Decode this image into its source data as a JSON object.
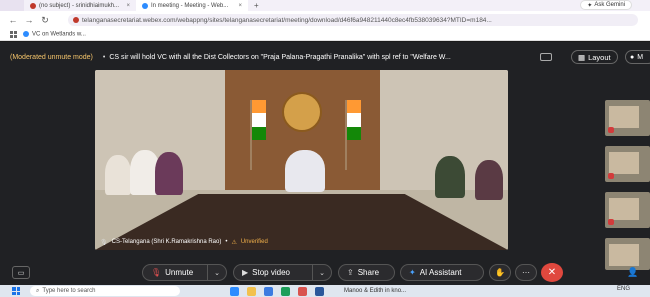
{
  "browser": {
    "tabs": [
      {
        "label": "(no subject) - srinidhiaimukh..."
      },
      {
        "label": "In meeting - Meeting - Web..."
      }
    ],
    "new_tab": "+",
    "gemini": "Ask Gemini",
    "url": "telanganasecretariat.webex.com/webappng/sites/telanganasecretariat/meeting/download/d46f6a948211440c8ec4fb538039634?MTID=m184...",
    "bookmark": "VC on Wetlands w..."
  },
  "meeting": {
    "moderated": "(Moderated unmute mode)",
    "topic": "CS sir will hold VC with all the Dist Collectors on \"Praja Palana-Pragathi Pranalika\" with spl ref to \"Welfare W...",
    "layout_label": "Layout",
    "more_label": "M",
    "speaker_name": "CS-Telangana (Shri K.Ramakrishna Rao)",
    "unverified": "Unverified"
  },
  "controls": {
    "unmute": "Unmute",
    "stop_video": "Stop video",
    "share": "Share",
    "ai_assistant": "AI Assistant"
  },
  "taskbar": {
    "search_placeholder": "Type here to search",
    "task_label": "Manoo & Edith in kno...",
    "lang": "ENG"
  },
  "colors": {
    "end_call": "#e0483e",
    "moderated": "#f5c56b",
    "unverified": "#f0b04a"
  }
}
